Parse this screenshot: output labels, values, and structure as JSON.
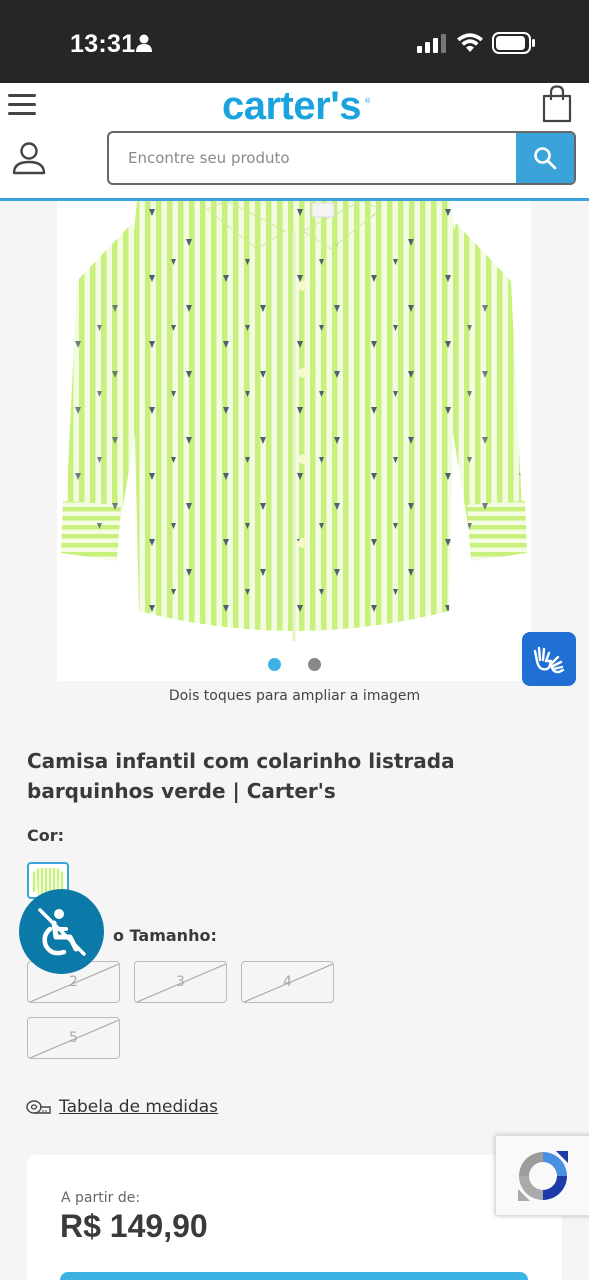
{
  "status_bar": {
    "time": "13:31"
  },
  "header": {
    "logo": "carter's",
    "search_placeholder": "Encontre seu produto"
  },
  "product": {
    "image_hint": "Dois toques para ampliar a imagem",
    "gallery_count": 2,
    "gallery_active_index": 0,
    "title": "Camisa infantil com colarinho listrada barquinhos verde | Carter's",
    "color_label": "Cor:",
    "size_label": "o Tamanho:",
    "sizes": [
      "2",
      "3",
      "4",
      "5"
    ],
    "sizes_available": [
      false,
      false,
      false,
      false
    ],
    "size_chart_link": "Tabela de medidas",
    "price_from_label": "A partir de:",
    "price": "R$ 149,90"
  },
  "colors": {
    "brand": "#1aa3dc",
    "accent": "#3aa3d9",
    "shirt_green": "#c6f07a"
  }
}
